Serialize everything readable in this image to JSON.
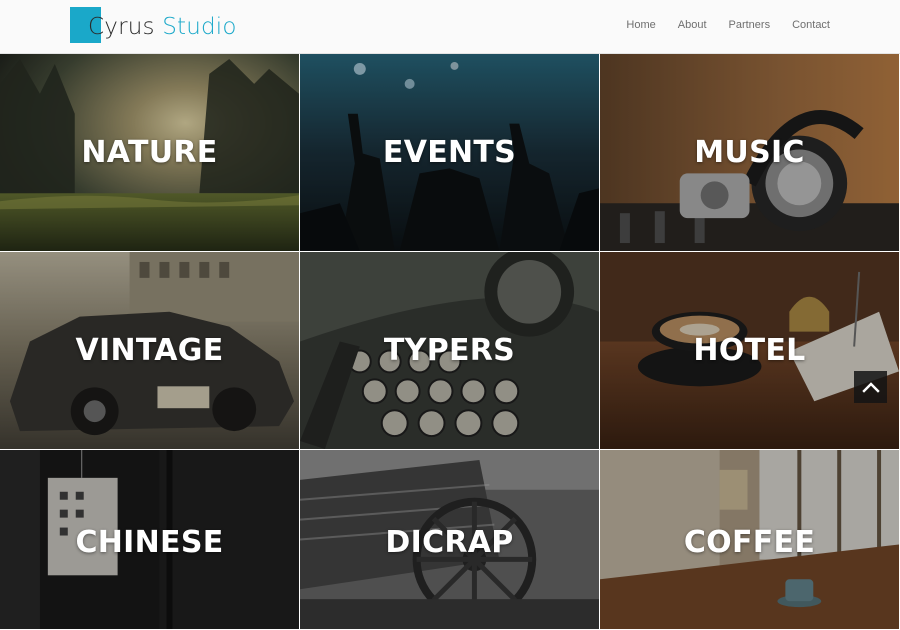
{
  "header": {
    "logo_part1": "Cyrus",
    "logo_part2": "Studio",
    "nav": [
      "Home",
      "About",
      "Partners",
      "Contact"
    ]
  },
  "tiles": [
    {
      "label": "NATURE"
    },
    {
      "label": "EVENTS"
    },
    {
      "label": "MUSIC"
    },
    {
      "label": "VINTAGE"
    },
    {
      "label": "TYPERS"
    },
    {
      "label": "HOTEL"
    },
    {
      "label": "CHINESE"
    },
    {
      "label": "DICRAP"
    },
    {
      "label": "COFFEE"
    }
  ],
  "icons": {
    "back_to_top": "chevron-up-icon"
  },
  "colors": {
    "accent": "#1aa8c9",
    "header_bg": "#fafafa",
    "nav_text": "#6f6f6f"
  }
}
